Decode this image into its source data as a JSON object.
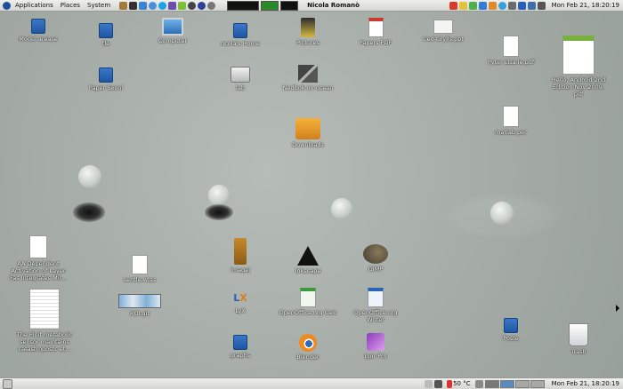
{
  "top_panel": {
    "menus": [
      "Applications",
      "Places",
      "System"
    ],
    "user": "Nicola Romanò",
    "clock": "Mon Feb 21, 18:20:19"
  },
  "bottom_panel": {
    "temperature": "50 °C",
    "clock": "Mon Feb 21, 18:20:19"
  },
  "desktop_icons": [
    {
      "label": "Model arease",
      "kind": "folder"
    },
    {
      "label": "tle",
      "kind": "folder"
    },
    {
      "label": "Computer",
      "kind": "computer"
    },
    {
      "label": "ncola's Home",
      "kind": "home"
    },
    {
      "label": "Pictures",
      "kind": "pictures"
    },
    {
      "label": "Papers PDF",
      "kind": "pdf"
    },
    {
      "label": "Ced-Crylls.ppt",
      "kind": "ppt"
    },
    {
      "label": "Pyter Lisa.le.pdf",
      "kind": "doc"
    },
    {
      "label": "Hello, Android 2nd Edition Nov 2009. pdf",
      "kind": "book"
    },
    {
      "label": "Paper Seoni",
      "kind": "folder"
    },
    {
      "label": "lab",
      "kind": "printer"
    },
    {
      "label": "Nedbok on ocean",
      "kind": "network"
    },
    {
      "label": "matlab.per",
      "kind": "doc"
    },
    {
      "label": "Downloads",
      "kind": "downloads"
    },
    {
      "label": "AA Dependent Activation of Layer Fas Integrates Mir...",
      "kind": "doc"
    },
    {
      "label": "sentle.wtss",
      "kind": "doc"
    },
    {
      "label": "Imagej",
      "kind": "microscope"
    },
    {
      "label": "Inkscape",
      "kind": "inkscape"
    },
    {
      "label": "GIMP",
      "kind": "gimp"
    },
    {
      "label": "ROI.git",
      "kind": "image"
    },
    {
      "label": "LyX",
      "kind": "lyx"
    },
    {
      "label": "OpenOffice.org Calc",
      "kind": "calc"
    },
    {
      "label": "OpenOffice.org Writer",
      "kind": "writer"
    },
    {
      "label": "The Pinit metabolic sensor maintains catastropostc et...",
      "kind": "paper"
    },
    {
      "label": "graphs",
      "kind": "folder"
    },
    {
      "label": "Blender",
      "kind": "blender"
    },
    {
      "label": "Igor Pro",
      "kind": "igor"
    },
    {
      "label": "Poste",
      "kind": "folder"
    },
    {
      "label": "Trash",
      "kind": "trash"
    }
  ],
  "colors": {
    "folder": "#2a66b8",
    "panel": "#e2e2de",
    "wallpaper": "#a9afaa"
  }
}
